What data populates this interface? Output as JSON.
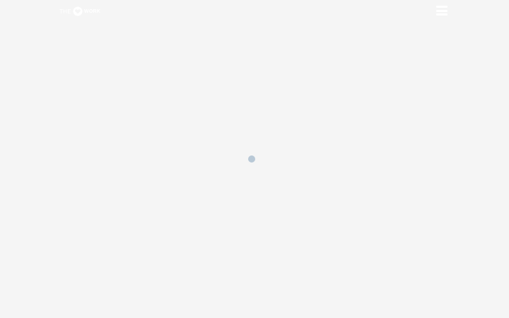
{
  "header": {
    "logo": {
      "left_text": "THE",
      "right_text": "WORK"
    }
  },
  "icons": {
    "menu": "hamburger-menu-icon",
    "logo": "heart-logo-icon",
    "loader": "loading-spinner-icon"
  },
  "colors": {
    "background": "#f5f5f5",
    "header_foreground": "#ffffff",
    "loader": "#b8c8d6"
  }
}
